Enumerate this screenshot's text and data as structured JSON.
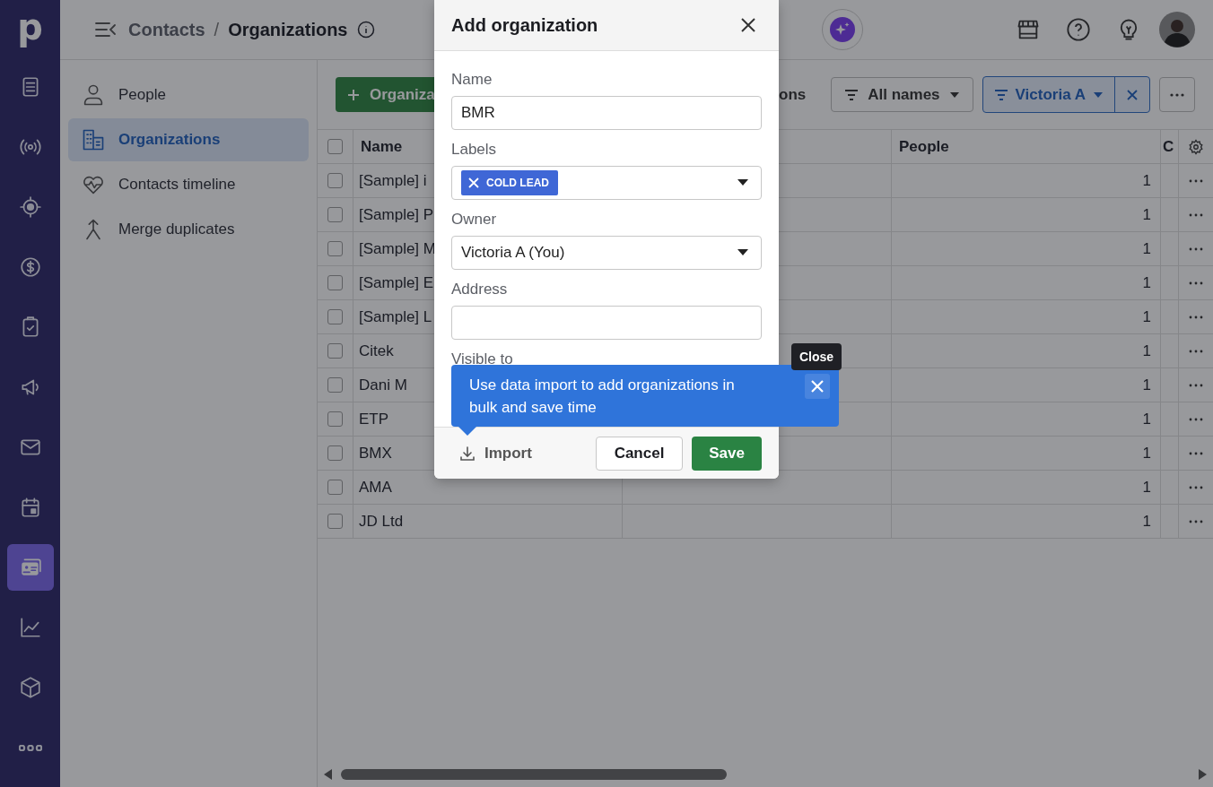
{
  "app_nav": {
    "logo": "p",
    "items": [
      {
        "selected": false
      },
      {
        "selected": false
      },
      {
        "selected": false
      },
      {
        "selected": false
      },
      {
        "selected": false
      },
      {
        "selected": false
      },
      {
        "selected": false
      },
      {
        "selected": false
      },
      {
        "selected": true
      },
      {
        "selected": false
      },
      {
        "selected": false
      },
      {
        "selected": false
      }
    ]
  },
  "header": {
    "breadcrumb_parent": "Contacts",
    "separator": "/",
    "title": "Organizations"
  },
  "subnav": {
    "items": [
      {
        "label": "People",
        "selected": false
      },
      {
        "label": "Organizations",
        "selected": true
      },
      {
        "label": "Contacts timeline",
        "selected": false
      },
      {
        "label": "Merge duplicates",
        "selected": false
      }
    ]
  },
  "toolbar": {
    "add_button": "Organiza",
    "partial_text": "ons",
    "names_filter": "All names",
    "owner_filter": "Victoria A"
  },
  "table": {
    "header_checked": false,
    "columns": {
      "name": "Name",
      "people": "People",
      "column_4": "C"
    },
    "rows": [
      {
        "checked": false,
        "name": "[Sample] i",
        "people": "1"
      },
      {
        "checked": false,
        "name": "[Sample] P",
        "people": "1"
      },
      {
        "checked": false,
        "name": "[Sample] M",
        "people": "1"
      },
      {
        "checked": false,
        "name": "[Sample] E",
        "people": "1"
      },
      {
        "checked": false,
        "name": "[Sample] L",
        "people": "1"
      },
      {
        "checked": false,
        "name": "Citek",
        "people": "1"
      },
      {
        "checked": false,
        "name": "Dani M",
        "people": "1"
      },
      {
        "checked": false,
        "name": "ETP",
        "people": "1"
      },
      {
        "checked": false,
        "name": "BMX",
        "people": "1"
      },
      {
        "checked": false,
        "name": "AMA",
        "people": "1"
      },
      {
        "checked": false,
        "name": "JD Ltd",
        "people": "1"
      }
    ]
  },
  "modal": {
    "title": "Add organization",
    "fields": [
      {
        "label": "Name",
        "kind": "text",
        "value": "BMR"
      },
      {
        "label": "Labels",
        "kind": "labels",
        "chips": [
          "COLD LEAD"
        ]
      },
      {
        "label": "Owner",
        "kind": "select",
        "value": "Victoria A (You)"
      },
      {
        "label": "Address",
        "kind": "text"
      },
      {
        "label": "Visible to",
        "kind": "label"
      }
    ],
    "import": "Import",
    "cancel": "Cancel",
    "save": "Save"
  },
  "popover": {
    "text": "Use data import to add organizations in bulk and save time",
    "close_tooltip": "Close"
  }
}
